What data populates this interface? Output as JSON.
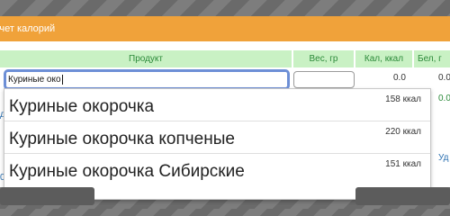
{
  "window": {
    "title": "счет калорий"
  },
  "table": {
    "headers": {
      "product": "Продукт",
      "weight": "Вес, гр",
      "kcal": "Кал, ккал",
      "protein": "Бел, г"
    },
    "row": {
      "product_value": "Куриные око",
      "weight_value": "",
      "kcal_value": "0.0",
      "protein_value": "0.0"
    }
  },
  "suggestions": [
    {
      "name": "Куриные окорочка",
      "kcal": "158 ккал"
    },
    {
      "name": "Куриные окорочка копченые",
      "kcal": "220 ккал"
    },
    {
      "name": "Куриные окорочка Сибирские",
      "kcal": "151 ккал"
    }
  ],
  "partial": {
    "green_value": "0.0",
    "left_fragment": "д",
    "left_fragment_2": "0",
    "delete_link": "Уд"
  },
  "colors": {
    "title_bar": "#f0a23a",
    "header_bg": "#c9f1c4",
    "header_text": "#2c8a3a",
    "focus_border": "#6d8fd6"
  }
}
